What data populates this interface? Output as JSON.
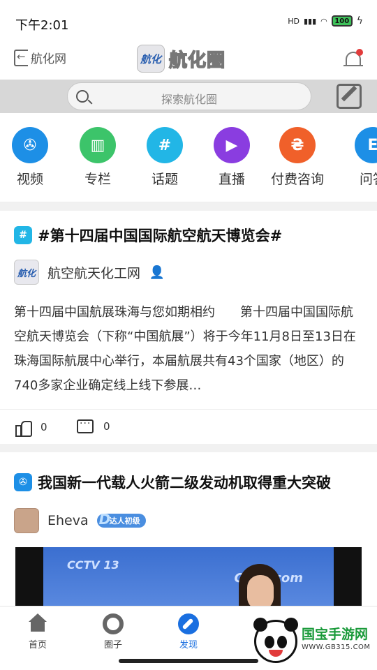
{
  "status_bar": {
    "time": "下午2:01",
    "network": "HD",
    "battery": "100"
  },
  "header": {
    "back_label": "航化网",
    "logo_mark": "航化",
    "logo_text": "航化圈"
  },
  "search": {
    "placeholder": "探索航化圈"
  },
  "categories": [
    {
      "label": "视频",
      "icon": "video-reel-icon",
      "color": "#1d8fe6",
      "glyph": "✇"
    },
    {
      "label": "专栏",
      "icon": "book-icon",
      "color": "#3cc46a",
      "glyph": "▥"
    },
    {
      "label": "话题",
      "icon": "hashtag-chat-icon",
      "color": "#22b6e6",
      "glyph": "#"
    },
    {
      "label": "直播",
      "icon": "camera-icon",
      "color": "#8a3de0",
      "glyph": "▶"
    },
    {
      "label": "付费咨询",
      "icon": "lock-icon",
      "color": "#f0602a",
      "glyph": "₴"
    },
    {
      "label": "问答",
      "icon": "qa-icon",
      "color": "#1d8fe6",
      "glyph": "E"
    }
  ],
  "posts": [
    {
      "badge_color": "#22b6e6",
      "badge_icon": "hashtag-chat-icon",
      "badge_glyph": "#",
      "title": "#第十四届中国国际航空航天博览会#",
      "author": "航空航天化工网",
      "avatar_text": "航化",
      "body": "第十四届中国航展珠海与您如期相约　　第十四届中国国际航空航天博览会（下称“中国航展”）将于今年11月8日至13日在珠海国际航展中心举行，本届航展共有43个国家（地区）的740多家企业确定线上线下参展…",
      "likes": "0",
      "comments": "0"
    },
    {
      "badge_color": "#1d8fe6",
      "badge_icon": "video-reel-icon",
      "badge_glyph": "✇",
      "title": "我国新一代载人火箭二级发动机取得重大突破",
      "author": "Eheva",
      "level": "达人初级",
      "video_logo": "CCTV 13",
      "video_logo2": "CCTV.com"
    }
  ],
  "bottom_nav": [
    {
      "label": "首页",
      "icon": "home-icon"
    },
    {
      "label": "圈子",
      "icon": "circle-icon"
    },
    {
      "label": "发现",
      "icon": "compass-icon",
      "active": true
    }
  ],
  "watermark": {
    "title": "国宝手游网",
    "url": "WWW.GB315.COM"
  }
}
